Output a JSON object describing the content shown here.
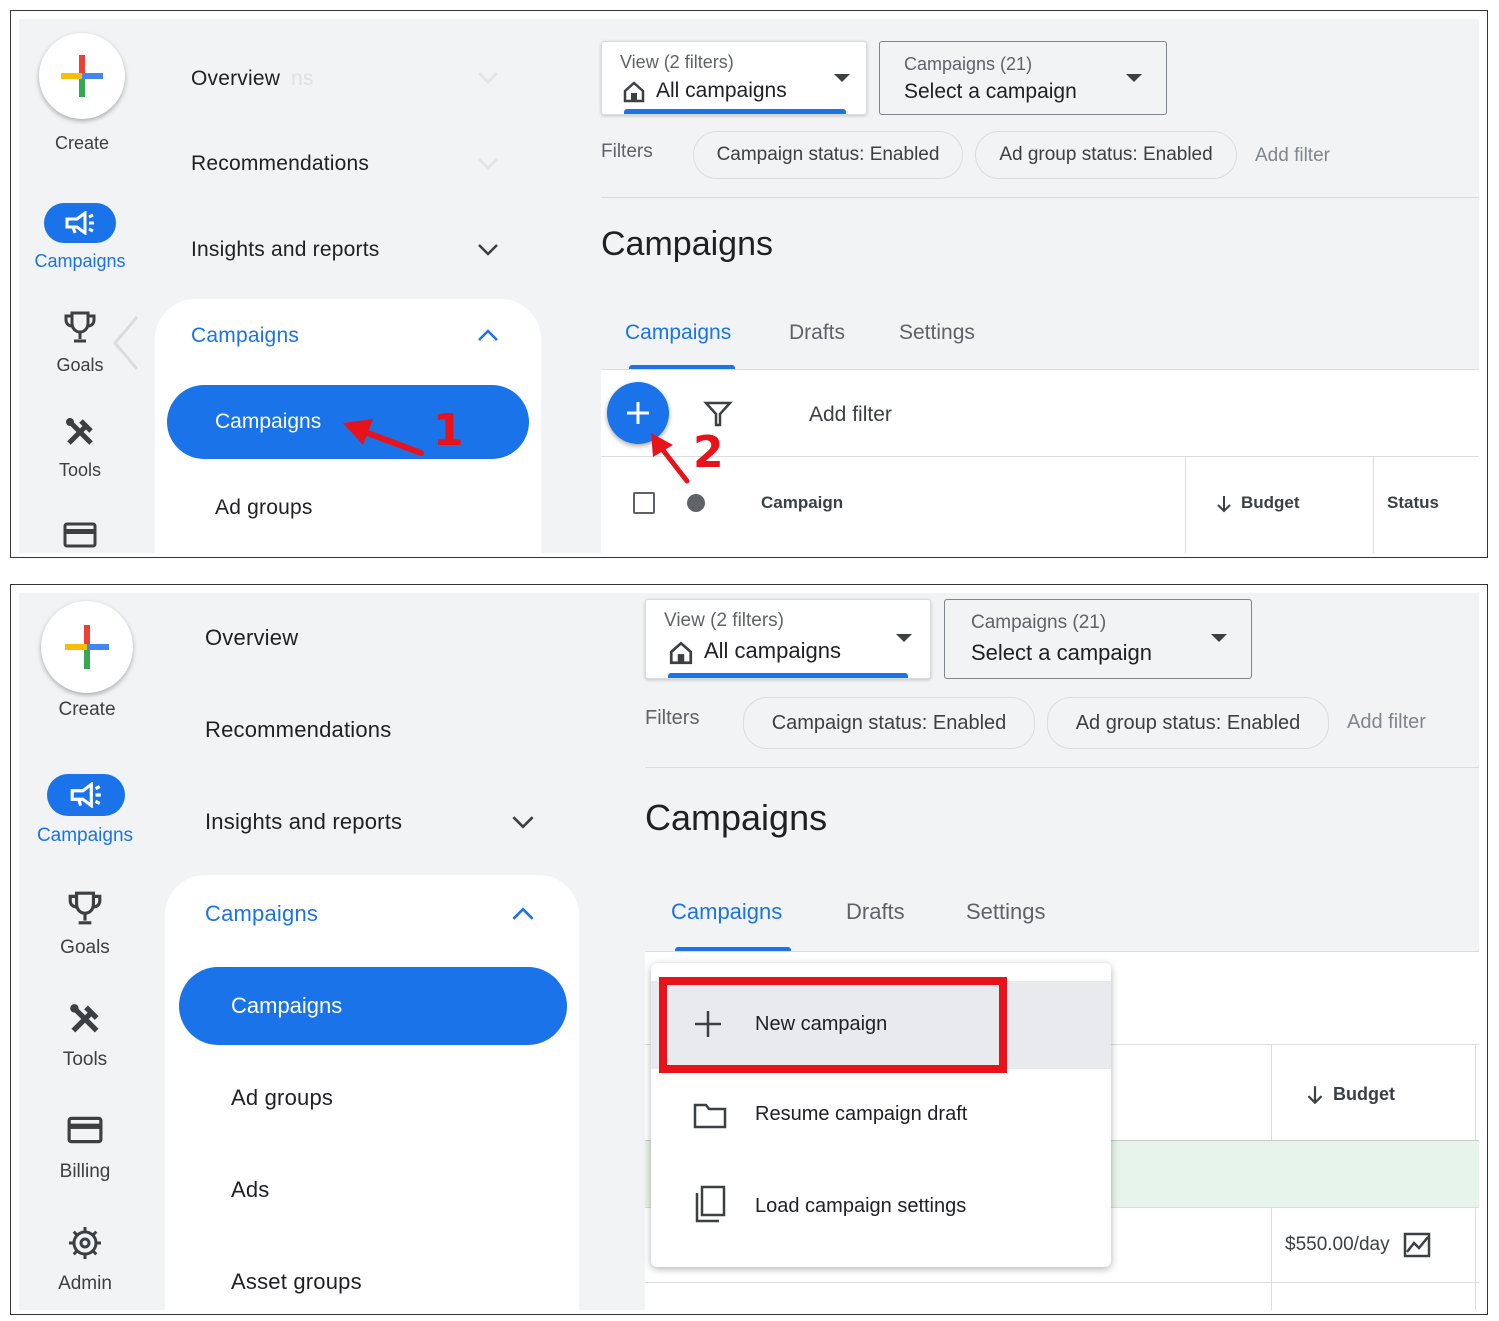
{
  "rail": {
    "create": "Create",
    "campaigns": "Campaigns",
    "goals": "Goals",
    "tools": "Tools",
    "billing": "Billing",
    "admin": "Admin"
  },
  "nav": {
    "overview": "Overview",
    "recommendations": "Recommendations",
    "insights": "Insights and reports",
    "campaigns_section": "Campaigns",
    "campaigns_item": "Campaigns",
    "ad_groups": "Ad groups",
    "ads": "Ads",
    "asset_groups": "Asset groups",
    "overview_ghost": "ns"
  },
  "view_dropdown": {
    "label": "View (2 filters)",
    "value": "All campaigns"
  },
  "campaign_dropdown": {
    "label": "Campaigns (21)",
    "value": "Select a campaign"
  },
  "filters": {
    "label": "Filters",
    "chip_campaign_status": "Campaign status: Enabled",
    "chip_ad_group_status": "Ad group status: Enabled",
    "add_filter": "Add filter"
  },
  "page_title": "Campaigns",
  "tabs": {
    "campaigns": "Campaigns",
    "drafts": "Drafts",
    "settings": "Settings"
  },
  "table": {
    "add_filter": "Add filter",
    "col_campaign": "Campaign",
    "col_budget": "Budget",
    "col_status": "Status",
    "budget_value": "$550.00/day"
  },
  "menu": {
    "new_campaign": "New campaign",
    "resume_draft": "Resume campaign draft",
    "load_settings": "Load campaign settings"
  },
  "annotations": {
    "step1": "1",
    "step2": "2"
  },
  "colors": {
    "accent": "#1a73e8",
    "annotation": "#e8121a",
    "row_highlight": "#e6f4ea"
  }
}
